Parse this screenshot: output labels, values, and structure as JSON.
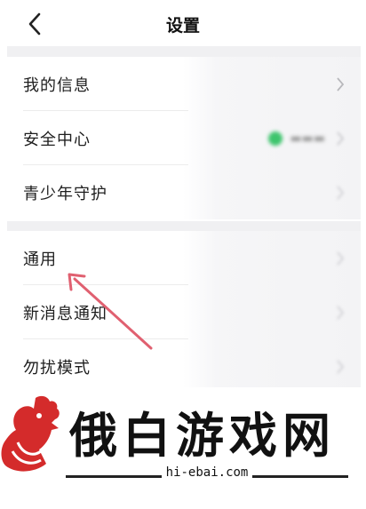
{
  "header": {
    "title": "设置"
  },
  "group1": {
    "items": [
      {
        "label": "我的信息"
      },
      {
        "label": "安全中心"
      },
      {
        "label": "青少年守护"
      }
    ]
  },
  "group2": {
    "items": [
      {
        "label": "通用"
      },
      {
        "label": "新消息通知"
      },
      {
        "label": "勿扰模式"
      }
    ]
  },
  "annotation": {
    "arrow_color": "#e06070"
  },
  "status": {
    "dot_color": "#3ec46d"
  },
  "watermark": {
    "name": "俄白游戏网",
    "domain": "hi-ebai.com",
    "brand_color": "#d42b2b"
  }
}
